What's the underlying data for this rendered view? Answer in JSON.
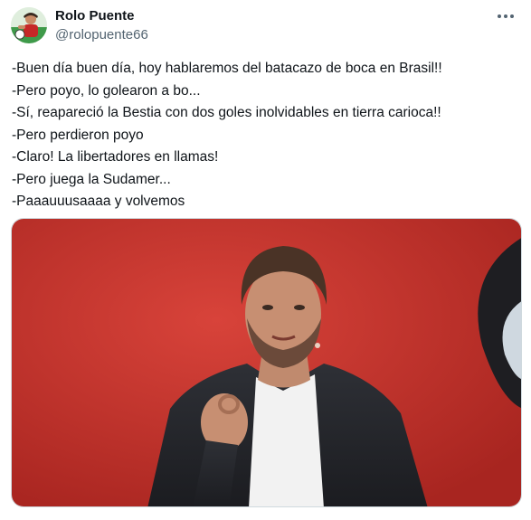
{
  "author": {
    "display_name": "Rolo Puente",
    "handle": "@rolopuente66",
    "avatar_icon": "avatar-photo"
  },
  "menu": {
    "icon": "more-horizontal-icon"
  },
  "tweet": {
    "lines": [
      "-Buen día buen día, hoy hablaremos del batacazo de boca en Brasil!!",
      "-Pero poyo, lo golearon a bo...",
      "-Sí, reapareció la Bestia con dos goles inolvidables en tierra carioca!!",
      "-Pero perdieron poyo",
      "-Claro! La libertadores en llamas!",
      "-Pero juega la Sudamer...",
      "-Paaauuusaaaa y volvemos"
    ]
  },
  "colors": {
    "text": "#0f1419",
    "secondary": "#536471",
    "media_background": "#c8302a"
  }
}
